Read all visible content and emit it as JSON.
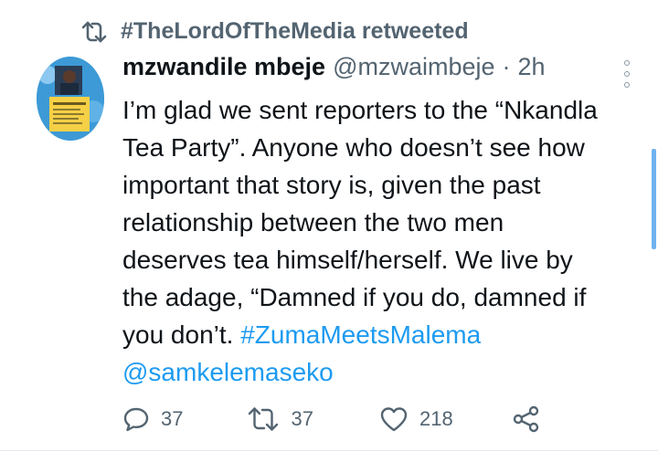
{
  "retweet": {
    "icon": "retweet-icon",
    "text": "#TheLordOfTheMedia retweeted"
  },
  "tweet": {
    "author_name": "mzwandile mbeje",
    "handle": "@mzwaimbeje",
    "separator": "·",
    "time": "2h",
    "text_lines": [
      "I’m glad we sent reporters to the “Nkandla",
      "Tea Party”. Anyone who doesn’t see how",
      "important that story is, given the past",
      "relationship between the two men",
      "deserves tea himself/herself. We live by",
      "the adage, “Damned if you do, damned if",
      "you don’t. "
    ],
    "hashtag": "#ZumaMeetsMalema",
    "mention": "@samkelemaseko"
  },
  "actions": {
    "replies": "37",
    "retweets": "37",
    "likes": "218"
  },
  "colors": {
    "link": "#1d9bf0",
    "secondary_text": "#536471",
    "primary_text": "#0f1419"
  }
}
